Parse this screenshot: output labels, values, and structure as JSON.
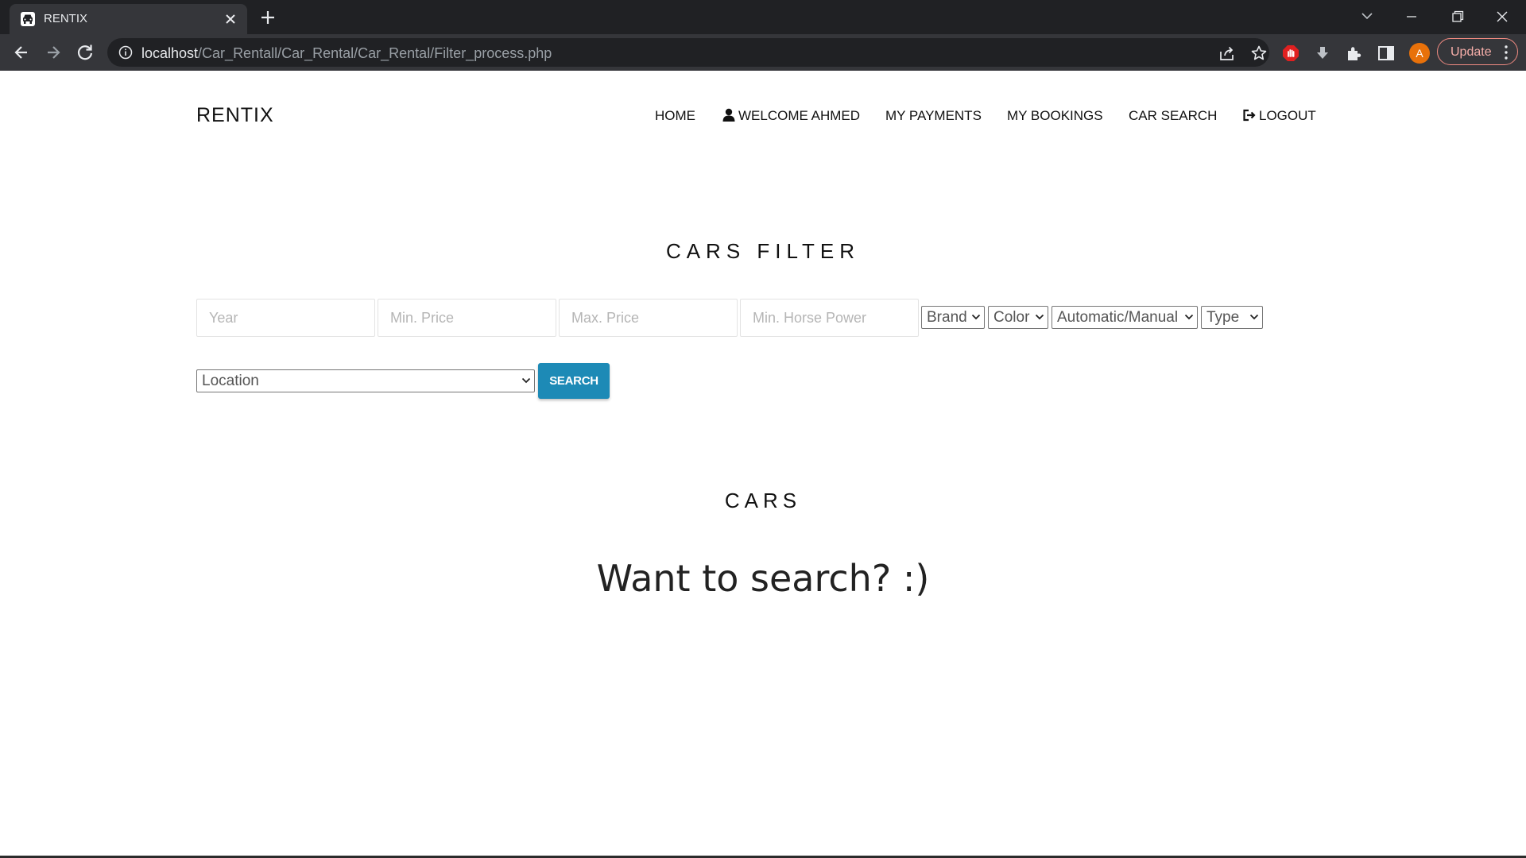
{
  "browser": {
    "tab_title": "RENTIX",
    "url_host": "localhost",
    "url_path": "/Car_Rentall/Car_Rental/Car_Rental/Filter_process.php",
    "profile_initial": "A",
    "update_label": "Update",
    "colors": {
      "chrome_dark": "#202124",
      "chrome_mid": "#35363a",
      "avatar": "#e8710a",
      "update_border": "#f28b82"
    }
  },
  "site": {
    "brand": "RENTIX",
    "nav": {
      "home": "HOME",
      "welcome": "WELCOME AHMED",
      "payments": "MY PAYMENTS",
      "bookings": "MY BOOKINGS",
      "car_search": "CAR SEARCH",
      "logout": "LOGOUT"
    }
  },
  "filter": {
    "title": "CARS FILTER",
    "year_placeholder": "Year",
    "min_price_placeholder": "Min. Price",
    "max_price_placeholder": "Max. Price",
    "min_hp_placeholder": "Min. Horse Power",
    "brand_selected": "Brand",
    "color_selected": "Color",
    "transmission_selected": "Automatic/Manual",
    "type_selected": "Type",
    "location_selected": "Location",
    "search_label": "SEARCH",
    "accent_color": "#1d8ab6"
  },
  "results": {
    "title": "CARS",
    "empty_message": "Want to search? :)"
  }
}
